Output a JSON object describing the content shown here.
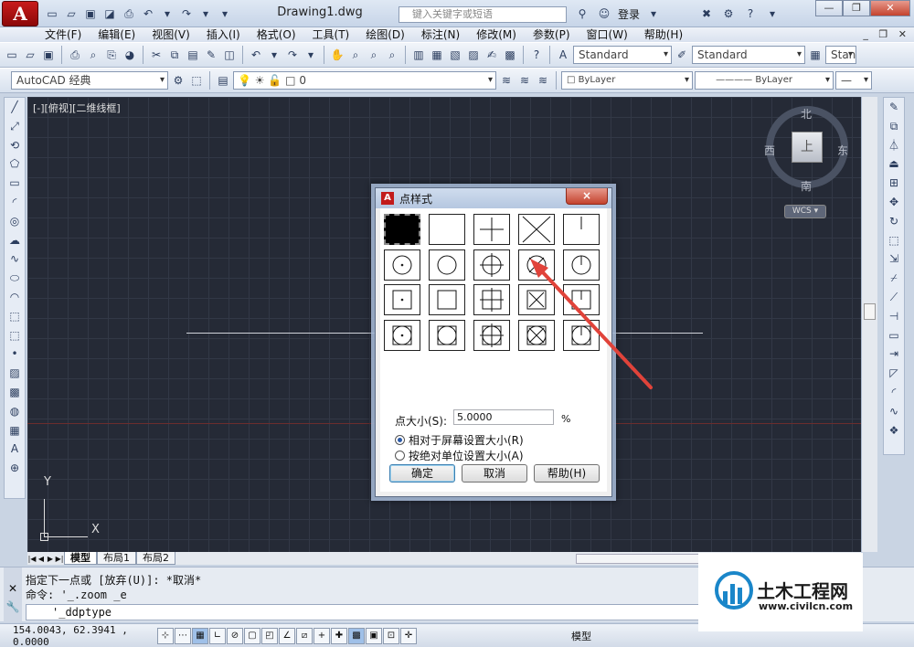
{
  "window": {
    "app_logo": "A",
    "title": "Drawing1.dwg",
    "search_placeholder": "键入关键字或短语",
    "login": "登录",
    "help": "?"
  },
  "menu": [
    "文件(F)",
    "编辑(E)",
    "视图(V)",
    "插入(I)",
    "格式(O)",
    "工具(T)",
    "绘图(D)",
    "标注(N)",
    "修改(M)",
    "参数(P)",
    "窗口(W)",
    "帮助(H)"
  ],
  "toolbar1": {
    "text_style": "Standard",
    "dim_style": "Standard",
    "table_style": "Stan"
  },
  "toolbar2": {
    "workspace": "AutoCAD 经典",
    "layer": "0",
    "color": "ByLayer",
    "linetype": "ByLayer"
  },
  "viewport": {
    "label": "[-][俯视][二维线框]"
  },
  "viewcube": {
    "top": "上",
    "north": "北",
    "south": "南",
    "east": "东",
    "west": "西",
    "wcs": "WCS"
  },
  "ucs": {
    "x_label": "X",
    "y_label": "Y"
  },
  "layout_tabs": [
    "模型",
    "布局1",
    "布局2"
  ],
  "command": {
    "line1": "指定下一点或 [放弃(U)]: *取消*",
    "line2": "命令: '_.zoom _e",
    "input": "'_ddptype"
  },
  "status": {
    "coords": "154.0043,  62.3941 , 0.0000",
    "model": "模型"
  },
  "dialog": {
    "title": "点样式",
    "close": "×",
    "point_size_label": "点大小(S):",
    "point_size_value": "5.0000",
    "unit": "%",
    "radio_relative": "相对于屏幕设置大小(R)",
    "radio_absolute": "按绝对单位设置大小(A)",
    "ok": "确定",
    "cancel": "取消",
    "help": "帮助(H)",
    "selected_style": 0
  },
  "watermark": {
    "title": "土木工程网",
    "url": "www.civilcn.com"
  }
}
